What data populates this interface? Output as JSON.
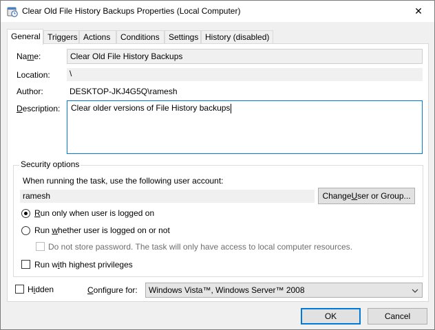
{
  "window": {
    "title": "Clear Old File History Backups Properties (Local Computer)",
    "close_glyph": "✕"
  },
  "tabs": [
    {
      "label": "General",
      "active": true
    },
    {
      "label": "Triggers",
      "active": false
    },
    {
      "label": "Actions",
      "active": false
    },
    {
      "label": "Conditions",
      "active": false
    },
    {
      "label": "Settings",
      "active": false
    },
    {
      "label": "History (disabled)",
      "active": false
    }
  ],
  "general": {
    "name_label_pre": "Na",
    "name_label_u": "m",
    "name_label_post": "e:",
    "name_value": "Clear Old File History Backups",
    "location_label": "Location:",
    "location_value": "\\",
    "author_label": "Author:",
    "author_value": "DESKTOP-JKJ4G5Q\\ramesh",
    "description_label_u": "D",
    "description_label_post": "escription:",
    "description_value": "Clear older versions of File History backups"
  },
  "security": {
    "group_title": "Security options",
    "account_prompt": "When running the task, use the following user account:",
    "account_value": "ramesh",
    "change_button_pre": "Change ",
    "change_button_u": "U",
    "change_button_post": "ser or Group...",
    "radio_logged_on_u": "R",
    "radio_logged_on_post": "un only when user is logged on",
    "radio_logged_on_selected": true,
    "radio_whether_pre": "Run ",
    "radio_whether_u": "w",
    "radio_whether_post": "hether user is logged on or not",
    "radio_whether_selected": false,
    "no_store_password": "Do not store password.  The task will only have access to local computer resources.",
    "highest_priv_pre": "Run w",
    "highest_priv_u": "i",
    "highest_priv_post": "th highest privileges"
  },
  "bottom": {
    "hidden_pre": "H",
    "hidden_u": "i",
    "hidden_post": "dden",
    "configure_label_pre": "",
    "configure_label_u": "C",
    "configure_label_post": "onfigure for:",
    "configure_value": "Windows Vista™, Windows Server™ 2008"
  },
  "buttons": {
    "ok": "OK",
    "cancel": "Cancel"
  },
  "colors": {
    "accent": "#0078d7",
    "panel_bg": "#ffffff",
    "dialog_bg": "#f0f0f0"
  }
}
